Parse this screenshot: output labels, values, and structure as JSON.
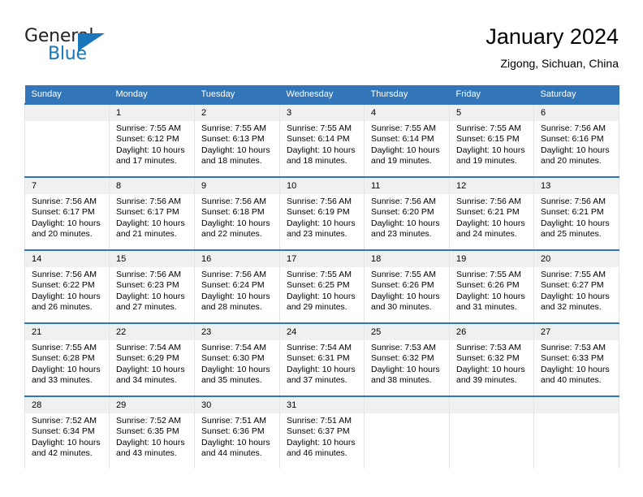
{
  "brand": {
    "name_part1": "General",
    "name_part2": "Blue",
    "triangle_color": "#1b75bb"
  },
  "header": {
    "title": "January 2024",
    "subtitle": "Zigong, Sichuan, China"
  },
  "theme": {
    "header_bg": "#3275b8",
    "daynum_bg": "#f0f0f0",
    "cell_border": "#e4e4e4"
  },
  "weekdays": [
    "Sunday",
    "Monday",
    "Tuesday",
    "Wednesday",
    "Thursday",
    "Friday",
    "Saturday"
  ],
  "labels": {
    "sunrise_prefix": "Sunrise:",
    "sunset_prefix": "Sunset:",
    "daylight_prefix": "Daylight:"
  },
  "weeks": [
    [
      {
        "day": "",
        "sunrise": "",
        "sunset": "",
        "daylight_line1": "",
        "daylight_line2": ""
      },
      {
        "day": "1",
        "sunrise": "Sunrise: 7:55 AM",
        "sunset": "Sunset: 6:12 PM",
        "daylight_line1": "Daylight: 10 hours",
        "daylight_line2": "and 17 minutes."
      },
      {
        "day": "2",
        "sunrise": "Sunrise: 7:55 AM",
        "sunset": "Sunset: 6:13 PM",
        "daylight_line1": "Daylight: 10 hours",
        "daylight_line2": "and 18 minutes."
      },
      {
        "day": "3",
        "sunrise": "Sunrise: 7:55 AM",
        "sunset": "Sunset: 6:14 PM",
        "daylight_line1": "Daylight: 10 hours",
        "daylight_line2": "and 18 minutes."
      },
      {
        "day": "4",
        "sunrise": "Sunrise: 7:55 AM",
        "sunset": "Sunset: 6:14 PM",
        "daylight_line1": "Daylight: 10 hours",
        "daylight_line2": "and 19 minutes."
      },
      {
        "day": "5",
        "sunrise": "Sunrise: 7:55 AM",
        "sunset": "Sunset: 6:15 PM",
        "daylight_line1": "Daylight: 10 hours",
        "daylight_line2": "and 19 minutes."
      },
      {
        "day": "6",
        "sunrise": "Sunrise: 7:56 AM",
        "sunset": "Sunset: 6:16 PM",
        "daylight_line1": "Daylight: 10 hours",
        "daylight_line2": "and 20 minutes."
      }
    ],
    [
      {
        "day": "7",
        "sunrise": "Sunrise: 7:56 AM",
        "sunset": "Sunset: 6:17 PM",
        "daylight_line1": "Daylight: 10 hours",
        "daylight_line2": "and 20 minutes."
      },
      {
        "day": "8",
        "sunrise": "Sunrise: 7:56 AM",
        "sunset": "Sunset: 6:17 PM",
        "daylight_line1": "Daylight: 10 hours",
        "daylight_line2": "and 21 minutes."
      },
      {
        "day": "9",
        "sunrise": "Sunrise: 7:56 AM",
        "sunset": "Sunset: 6:18 PM",
        "daylight_line1": "Daylight: 10 hours",
        "daylight_line2": "and 22 minutes."
      },
      {
        "day": "10",
        "sunrise": "Sunrise: 7:56 AM",
        "sunset": "Sunset: 6:19 PM",
        "daylight_line1": "Daylight: 10 hours",
        "daylight_line2": "and 23 minutes."
      },
      {
        "day": "11",
        "sunrise": "Sunrise: 7:56 AM",
        "sunset": "Sunset: 6:20 PM",
        "daylight_line1": "Daylight: 10 hours",
        "daylight_line2": "and 23 minutes."
      },
      {
        "day": "12",
        "sunrise": "Sunrise: 7:56 AM",
        "sunset": "Sunset: 6:21 PM",
        "daylight_line1": "Daylight: 10 hours",
        "daylight_line2": "and 24 minutes."
      },
      {
        "day": "13",
        "sunrise": "Sunrise: 7:56 AM",
        "sunset": "Sunset: 6:21 PM",
        "daylight_line1": "Daylight: 10 hours",
        "daylight_line2": "and 25 minutes."
      }
    ],
    [
      {
        "day": "14",
        "sunrise": "Sunrise: 7:56 AM",
        "sunset": "Sunset: 6:22 PM",
        "daylight_line1": "Daylight: 10 hours",
        "daylight_line2": "and 26 minutes."
      },
      {
        "day": "15",
        "sunrise": "Sunrise: 7:56 AM",
        "sunset": "Sunset: 6:23 PM",
        "daylight_line1": "Daylight: 10 hours",
        "daylight_line2": "and 27 minutes."
      },
      {
        "day": "16",
        "sunrise": "Sunrise: 7:56 AM",
        "sunset": "Sunset: 6:24 PM",
        "daylight_line1": "Daylight: 10 hours",
        "daylight_line2": "and 28 minutes."
      },
      {
        "day": "17",
        "sunrise": "Sunrise: 7:55 AM",
        "sunset": "Sunset: 6:25 PM",
        "daylight_line1": "Daylight: 10 hours",
        "daylight_line2": "and 29 minutes."
      },
      {
        "day": "18",
        "sunrise": "Sunrise: 7:55 AM",
        "sunset": "Sunset: 6:26 PM",
        "daylight_line1": "Daylight: 10 hours",
        "daylight_line2": "and 30 minutes."
      },
      {
        "day": "19",
        "sunrise": "Sunrise: 7:55 AM",
        "sunset": "Sunset: 6:26 PM",
        "daylight_line1": "Daylight: 10 hours",
        "daylight_line2": "and 31 minutes."
      },
      {
        "day": "20",
        "sunrise": "Sunrise: 7:55 AM",
        "sunset": "Sunset: 6:27 PM",
        "daylight_line1": "Daylight: 10 hours",
        "daylight_line2": "and 32 minutes."
      }
    ],
    [
      {
        "day": "21",
        "sunrise": "Sunrise: 7:55 AM",
        "sunset": "Sunset: 6:28 PM",
        "daylight_line1": "Daylight: 10 hours",
        "daylight_line2": "and 33 minutes."
      },
      {
        "day": "22",
        "sunrise": "Sunrise: 7:54 AM",
        "sunset": "Sunset: 6:29 PM",
        "daylight_line1": "Daylight: 10 hours",
        "daylight_line2": "and 34 minutes."
      },
      {
        "day": "23",
        "sunrise": "Sunrise: 7:54 AM",
        "sunset": "Sunset: 6:30 PM",
        "daylight_line1": "Daylight: 10 hours",
        "daylight_line2": "and 35 minutes."
      },
      {
        "day": "24",
        "sunrise": "Sunrise: 7:54 AM",
        "sunset": "Sunset: 6:31 PM",
        "daylight_line1": "Daylight: 10 hours",
        "daylight_line2": "and 37 minutes."
      },
      {
        "day": "25",
        "sunrise": "Sunrise: 7:53 AM",
        "sunset": "Sunset: 6:32 PM",
        "daylight_line1": "Daylight: 10 hours",
        "daylight_line2": "and 38 minutes."
      },
      {
        "day": "26",
        "sunrise": "Sunrise: 7:53 AM",
        "sunset": "Sunset: 6:32 PM",
        "daylight_line1": "Daylight: 10 hours",
        "daylight_line2": "and 39 minutes."
      },
      {
        "day": "27",
        "sunrise": "Sunrise: 7:53 AM",
        "sunset": "Sunset: 6:33 PM",
        "daylight_line1": "Daylight: 10 hours",
        "daylight_line2": "and 40 minutes."
      }
    ],
    [
      {
        "day": "28",
        "sunrise": "Sunrise: 7:52 AM",
        "sunset": "Sunset: 6:34 PM",
        "daylight_line1": "Daylight: 10 hours",
        "daylight_line2": "and 42 minutes."
      },
      {
        "day": "29",
        "sunrise": "Sunrise: 7:52 AM",
        "sunset": "Sunset: 6:35 PM",
        "daylight_line1": "Daylight: 10 hours",
        "daylight_line2": "and 43 minutes."
      },
      {
        "day": "30",
        "sunrise": "Sunrise: 7:51 AM",
        "sunset": "Sunset: 6:36 PM",
        "daylight_line1": "Daylight: 10 hours",
        "daylight_line2": "and 44 minutes."
      },
      {
        "day": "31",
        "sunrise": "Sunrise: 7:51 AM",
        "sunset": "Sunset: 6:37 PM",
        "daylight_line1": "Daylight: 10 hours",
        "daylight_line2": "and 46 minutes."
      },
      {
        "day": "",
        "sunrise": "",
        "sunset": "",
        "daylight_line1": "",
        "daylight_line2": ""
      },
      {
        "day": "",
        "sunrise": "",
        "sunset": "",
        "daylight_line1": "",
        "daylight_line2": ""
      },
      {
        "day": "",
        "sunrise": "",
        "sunset": "",
        "daylight_line1": "",
        "daylight_line2": ""
      }
    ]
  ]
}
